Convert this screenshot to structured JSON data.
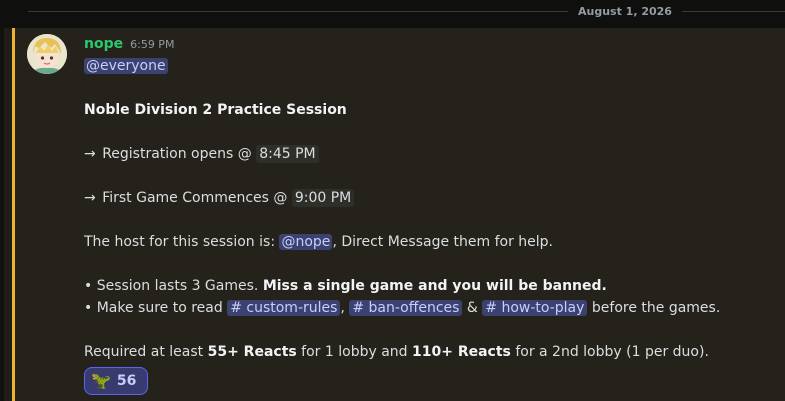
{
  "date_divider": "August 1, 2026",
  "message": {
    "username": "nope",
    "timestamp": "6:59 PM",
    "everyone_mention": "@everyone",
    "title": "Noble Division 2 Practice Session",
    "registration_prefix": "Registration opens @",
    "registration_time": "8:45 PM",
    "first_game_prefix": "First Game Commences @",
    "first_game_time": "9:00 PM",
    "host_prefix": "The host for this session is:",
    "host_mention": "@nope",
    "host_suffix": ", Direct Message them for help.",
    "bullet1_prefix": "• Session lasts 3 Games. ",
    "bullet1_bold": "Miss a single game and you will be banned.",
    "bullet2_prefix": "• Make sure to read",
    "channel1": "# custom-rules",
    "sep1": ",",
    "channel2": "# ban-offences",
    "sep2": "&",
    "channel3": "# how-to-play",
    "bullet2_suffix": "before the games.",
    "req_prefix": "Required at least ",
    "req_bold1": "55+ Reacts",
    "req_mid": " for 1 lobby and ",
    "req_bold2": "110+ Reacts",
    "req_suffix": " for a 2nd lobby (1 per duo).",
    "arrow": "→"
  },
  "reaction": {
    "emoji": "🦖",
    "emoji_name": "t-rex-icon",
    "count": "56"
  },
  "colors": {
    "accent_mention_bar": "#f0b232",
    "username": "#2dc770",
    "mention_bg": "#3c4270",
    "reaction_border": "#5865f2"
  }
}
